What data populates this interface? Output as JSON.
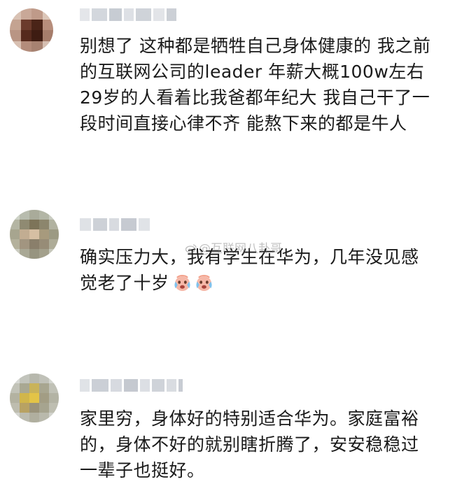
{
  "comments": [
    {
      "lines": [
        "别想了 这种都是牺牲自己身体健康的 我之前",
        "的互联网公司的leader 年薪大概100w左右",
        "29岁的人看着比我爸都年纪大 我自己干了一",
        "段时间直接心律不齐 能熬下来的都是牛人"
      ]
    },
    {
      "lines": [
        "确实压力大，我有学生在华为，几年没见感",
        "觉老了十岁"
      ],
      "emojis": [
        "crying-face-icon",
        "crying-face-icon"
      ]
    },
    {
      "lines": [
        "家里穷，身体好的特别适合华为。家庭富裕",
        "的，身体不好的就别瞎折腾了，安安稳稳过",
        "一辈子也挺好。"
      ]
    }
  ],
  "watermark": {
    "text": "@互联网八卦哥"
  }
}
